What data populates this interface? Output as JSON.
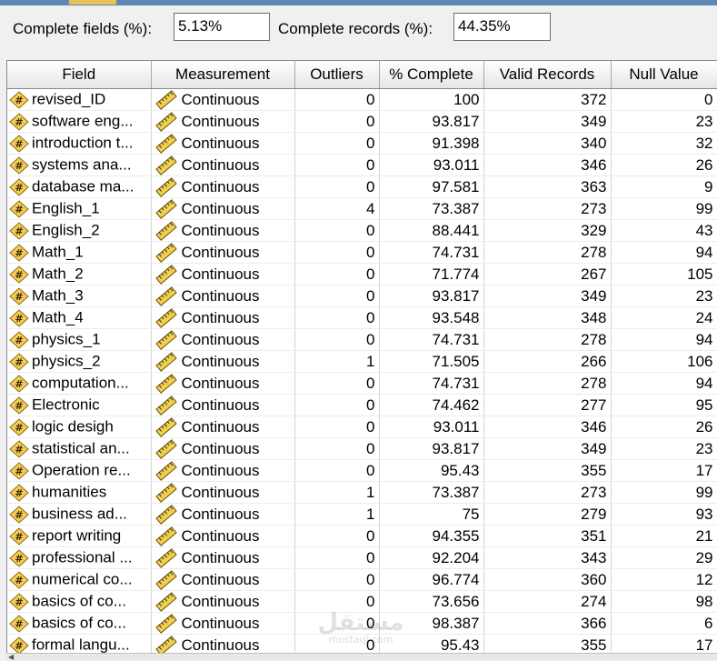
{
  "summary": {
    "complete_fields_label": "Complete fields (%):",
    "complete_fields_value": "5.13%",
    "complete_records_label": "Complete records (%):",
    "complete_records_value": "44.35%"
  },
  "table": {
    "headers": [
      "Field",
      "Measurement",
      "Outliers",
      "% Complete",
      "Valid Records",
      "Null Value"
    ],
    "rows": [
      [
        "revised_ID",
        "Continuous",
        "0",
        "100",
        "372",
        "0"
      ],
      [
        "software eng...",
        "Continuous",
        "0",
        "93.817",
        "349",
        "23"
      ],
      [
        "introduction t...",
        "Continuous",
        "0",
        "91.398",
        "340",
        "32"
      ],
      [
        "systems ana...",
        "Continuous",
        "0",
        "93.011",
        "346",
        "26"
      ],
      [
        "database ma...",
        "Continuous",
        "0",
        "97.581",
        "363",
        "9"
      ],
      [
        "English_1",
        "Continuous",
        "4",
        "73.387",
        "273",
        "99"
      ],
      [
        "English_2",
        "Continuous",
        "0",
        "88.441",
        "329",
        "43"
      ],
      [
        "Math_1",
        "Continuous",
        "0",
        "74.731",
        "278",
        "94"
      ],
      [
        "Math_2",
        "Continuous",
        "0",
        "71.774",
        "267",
        "105"
      ],
      [
        "Math_3",
        "Continuous",
        "0",
        "93.817",
        "349",
        "23"
      ],
      [
        "Math_4",
        "Continuous",
        "0",
        "93.548",
        "348",
        "24"
      ],
      [
        "physics_1",
        "Continuous",
        "0",
        "74.731",
        "278",
        "94"
      ],
      [
        "physics_2",
        "Continuous",
        "1",
        "71.505",
        "266",
        "106"
      ],
      [
        "computation...",
        "Continuous",
        "0",
        "74.731",
        "278",
        "94"
      ],
      [
        "Electronic",
        "Continuous",
        "0",
        "74.462",
        "277",
        "95"
      ],
      [
        "logic desigh",
        "Continuous",
        "0",
        "93.011",
        "346",
        "26"
      ],
      [
        "statistical an...",
        "Continuous",
        "0",
        "93.817",
        "349",
        "23"
      ],
      [
        "Operation re...",
        "Continuous",
        "0",
        "95.43",
        "355",
        "17"
      ],
      [
        "humanities",
        "Continuous",
        "1",
        "73.387",
        "273",
        "99"
      ],
      [
        "business ad...",
        "Continuous",
        "1",
        "75",
        "279",
        "93"
      ],
      [
        "report writing",
        "Continuous",
        "0",
        "94.355",
        "351",
        "21"
      ],
      [
        "professional ...",
        "Continuous",
        "0",
        "92.204",
        "343",
        "29"
      ],
      [
        "numerical co...",
        "Continuous",
        "0",
        "96.774",
        "360",
        "12"
      ],
      [
        "basics of co...",
        "Continuous",
        "0",
        "73.656",
        "274",
        "98"
      ],
      [
        "basics of co...",
        "Continuous",
        "0",
        "98.387",
        "366",
        "6"
      ],
      [
        "formal langu...",
        "Continuous",
        "0",
        "95.43",
        "355",
        "17"
      ]
    ]
  },
  "icons": {
    "field_type": "numeric-field-icon",
    "measurement": "ruler-icon"
  },
  "watermark": {
    "arabic": "مستقل",
    "latin": "mostaql.com"
  },
  "colors": {
    "title_bar": "#5f87b4",
    "active_tab": "#e9c15a"
  }
}
